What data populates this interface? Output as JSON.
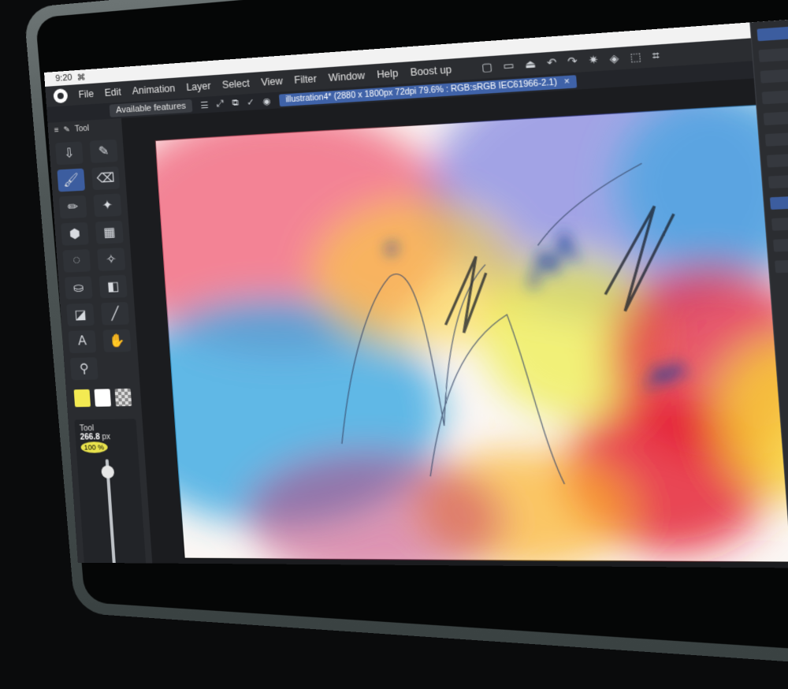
{
  "status_bar": {
    "time": "9:20"
  },
  "menu": {
    "items": [
      "File",
      "Edit",
      "Animation",
      "Layer",
      "Select",
      "View",
      "Filter",
      "Window",
      "Help",
      "Boost up"
    ]
  },
  "toolbar": {
    "available_features": "Available features"
  },
  "document": {
    "tab_title": "illustration4* (2880 x 1800px 72dpi 79.6% : RGB:sRGB IEC61966-2.1)",
    "close_glyph": "×"
  },
  "tool_panel": {
    "title": "Tool",
    "tools": [
      {
        "icon": "download-icon",
        "glyph": "⇩"
      },
      {
        "icon": "pen-icon",
        "glyph": "✎"
      },
      {
        "icon": "brush-icon",
        "glyph": "🖌"
      },
      {
        "icon": "eraser-icon",
        "glyph": "⌫"
      },
      {
        "icon": "pencil-icon",
        "glyph": "✏"
      },
      {
        "icon": "sparkle-icon",
        "glyph": "✦"
      },
      {
        "icon": "fill-icon",
        "glyph": "⬢"
      },
      {
        "icon": "grid-icon",
        "glyph": "▦"
      },
      {
        "icon": "lasso-icon",
        "glyph": "◌"
      },
      {
        "icon": "magic-wand-icon",
        "glyph": "✧"
      },
      {
        "icon": "bucket-icon",
        "glyph": "⛀"
      },
      {
        "icon": "gradient-icon",
        "glyph": "◧"
      },
      {
        "icon": "shape-icon",
        "glyph": "◪"
      },
      {
        "icon": "line-icon",
        "glyph": "╱"
      },
      {
        "icon": "text-icon",
        "glyph": "A"
      },
      {
        "icon": "hand-icon",
        "glyph": "✋"
      },
      {
        "icon": "eyedropper-icon",
        "glyph": "⚲"
      }
    ]
  },
  "brush_size": {
    "value": "266.8",
    "unit": "px",
    "tool_label": "Tool",
    "opacity": "100 %"
  },
  "colors": {
    "main": "#f3ea52",
    "sub": "#ffffff",
    "accent": "#3c5d9f"
  }
}
